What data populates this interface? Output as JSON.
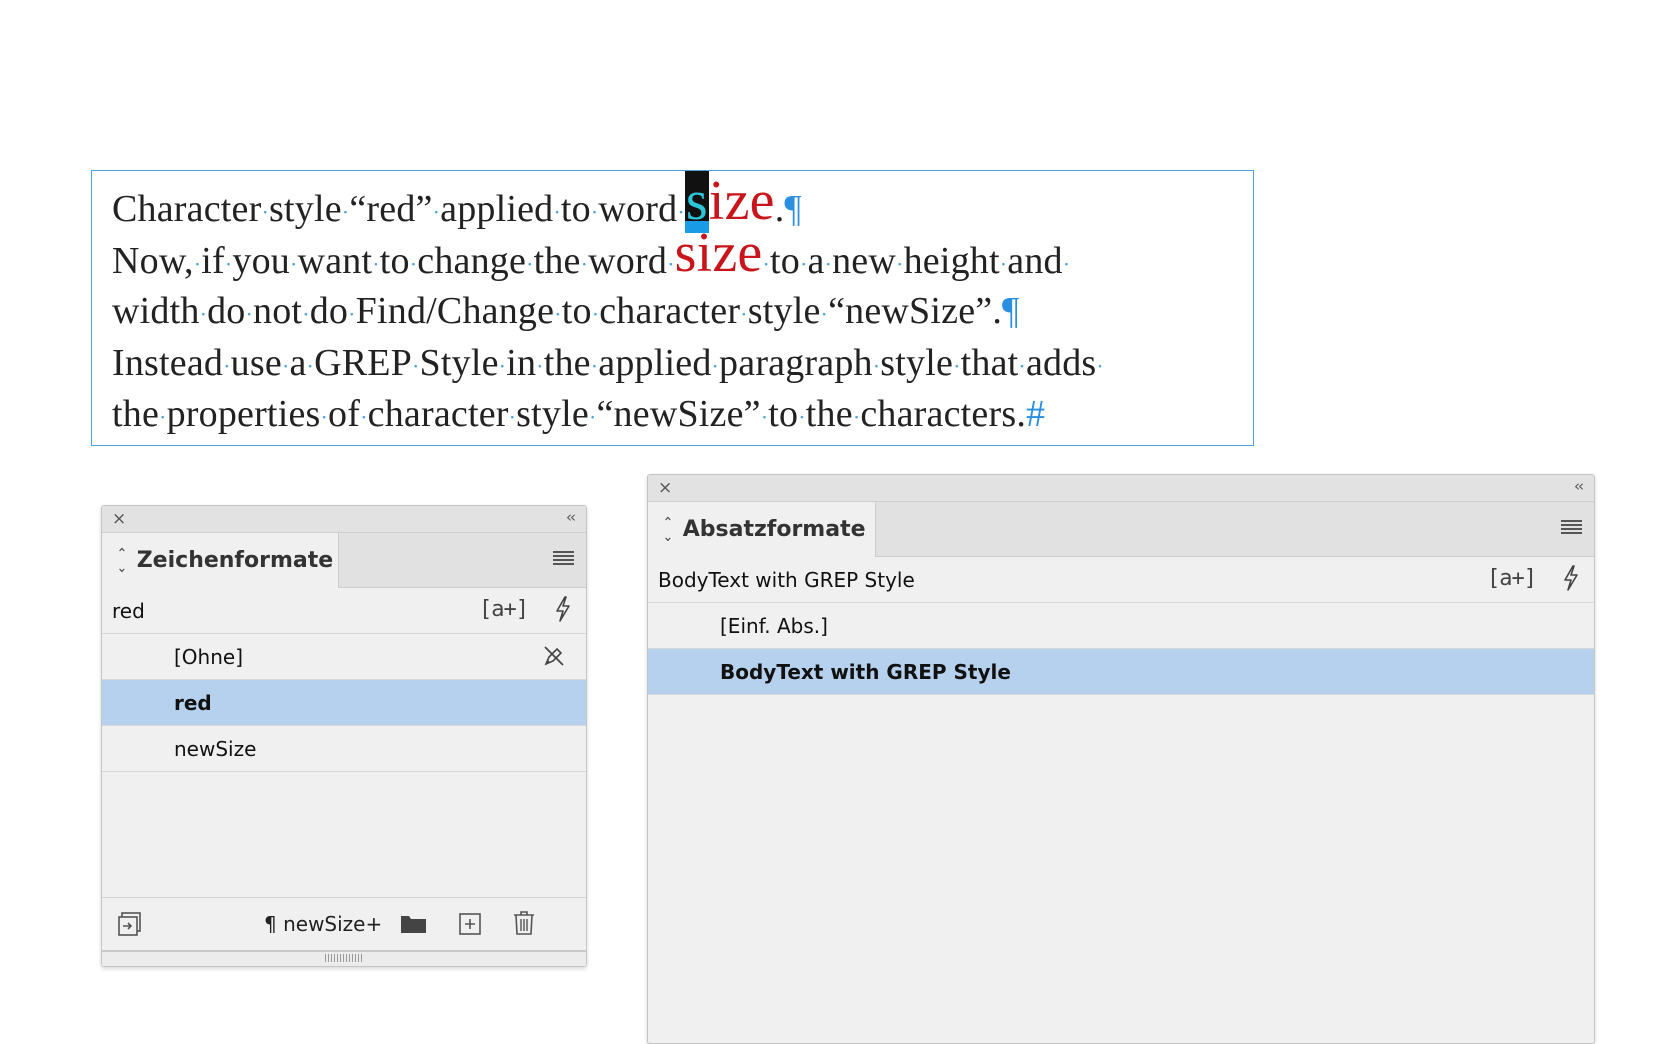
{
  "text_frame": {
    "line1": {
      "before": [
        "Character",
        "style",
        "“red”",
        "applied",
        "to",
        "word"
      ],
      "word_s": "s",
      "word_rest": "ize",
      "after": ".",
      "pilcrow": "¶"
    },
    "line2": {
      "before": [
        "Now,",
        "if",
        "you",
        "want",
        "to",
        "change",
        "the",
        "word"
      ],
      "size_word": "size",
      "after": [
        "to",
        "a",
        "new",
        "height",
        "and"
      ]
    },
    "line3": {
      "words": [
        "width",
        "do",
        "not",
        "do",
        "Find/Change",
        "to",
        "character",
        "style",
        "“newSize”."
      ],
      "pilcrow": "¶"
    },
    "line4": {
      "words": [
        "Instead",
        "use",
        "a",
        "GREP",
        "Style",
        "in",
        "the",
        "applied",
        "paragraph",
        "style",
        "that",
        "adds"
      ]
    },
    "line5": {
      "words": [
        "the",
        "properties",
        "of",
        "character",
        "style",
        "“newSize”",
        "to",
        "the",
        "characters."
      ],
      "endmark": "#"
    },
    "space_marker": "·"
  },
  "char_panel": {
    "tab_label": "Zeichenformate",
    "current_style": "red",
    "bracket_icon": "[a+]",
    "items": [
      {
        "label": "[Ohne]",
        "selected": false
      },
      {
        "label": "red",
        "selected": true
      },
      {
        "label": "newSize",
        "selected": false
      }
    ],
    "footer_label": "¶ newSize+"
  },
  "para_panel": {
    "tab_label": "Absatzformate",
    "current_style": "BodyText with GREP Style",
    "bracket_icon": "[a+]",
    "items": [
      {
        "label": "[Einf. Abs.]",
        "selected": false
      },
      {
        "label": "BodyText with GREP Style",
        "selected": true
      }
    ]
  },
  "icons": {
    "close": "×",
    "collapse": "‹‹",
    "tab_arrows": "↕"
  },
  "colors": {
    "frame_border": "#4aa3df",
    "red_style": "#c8151b",
    "selection": "#b5d1ed",
    "invisibles": "#2a8fe0"
  }
}
